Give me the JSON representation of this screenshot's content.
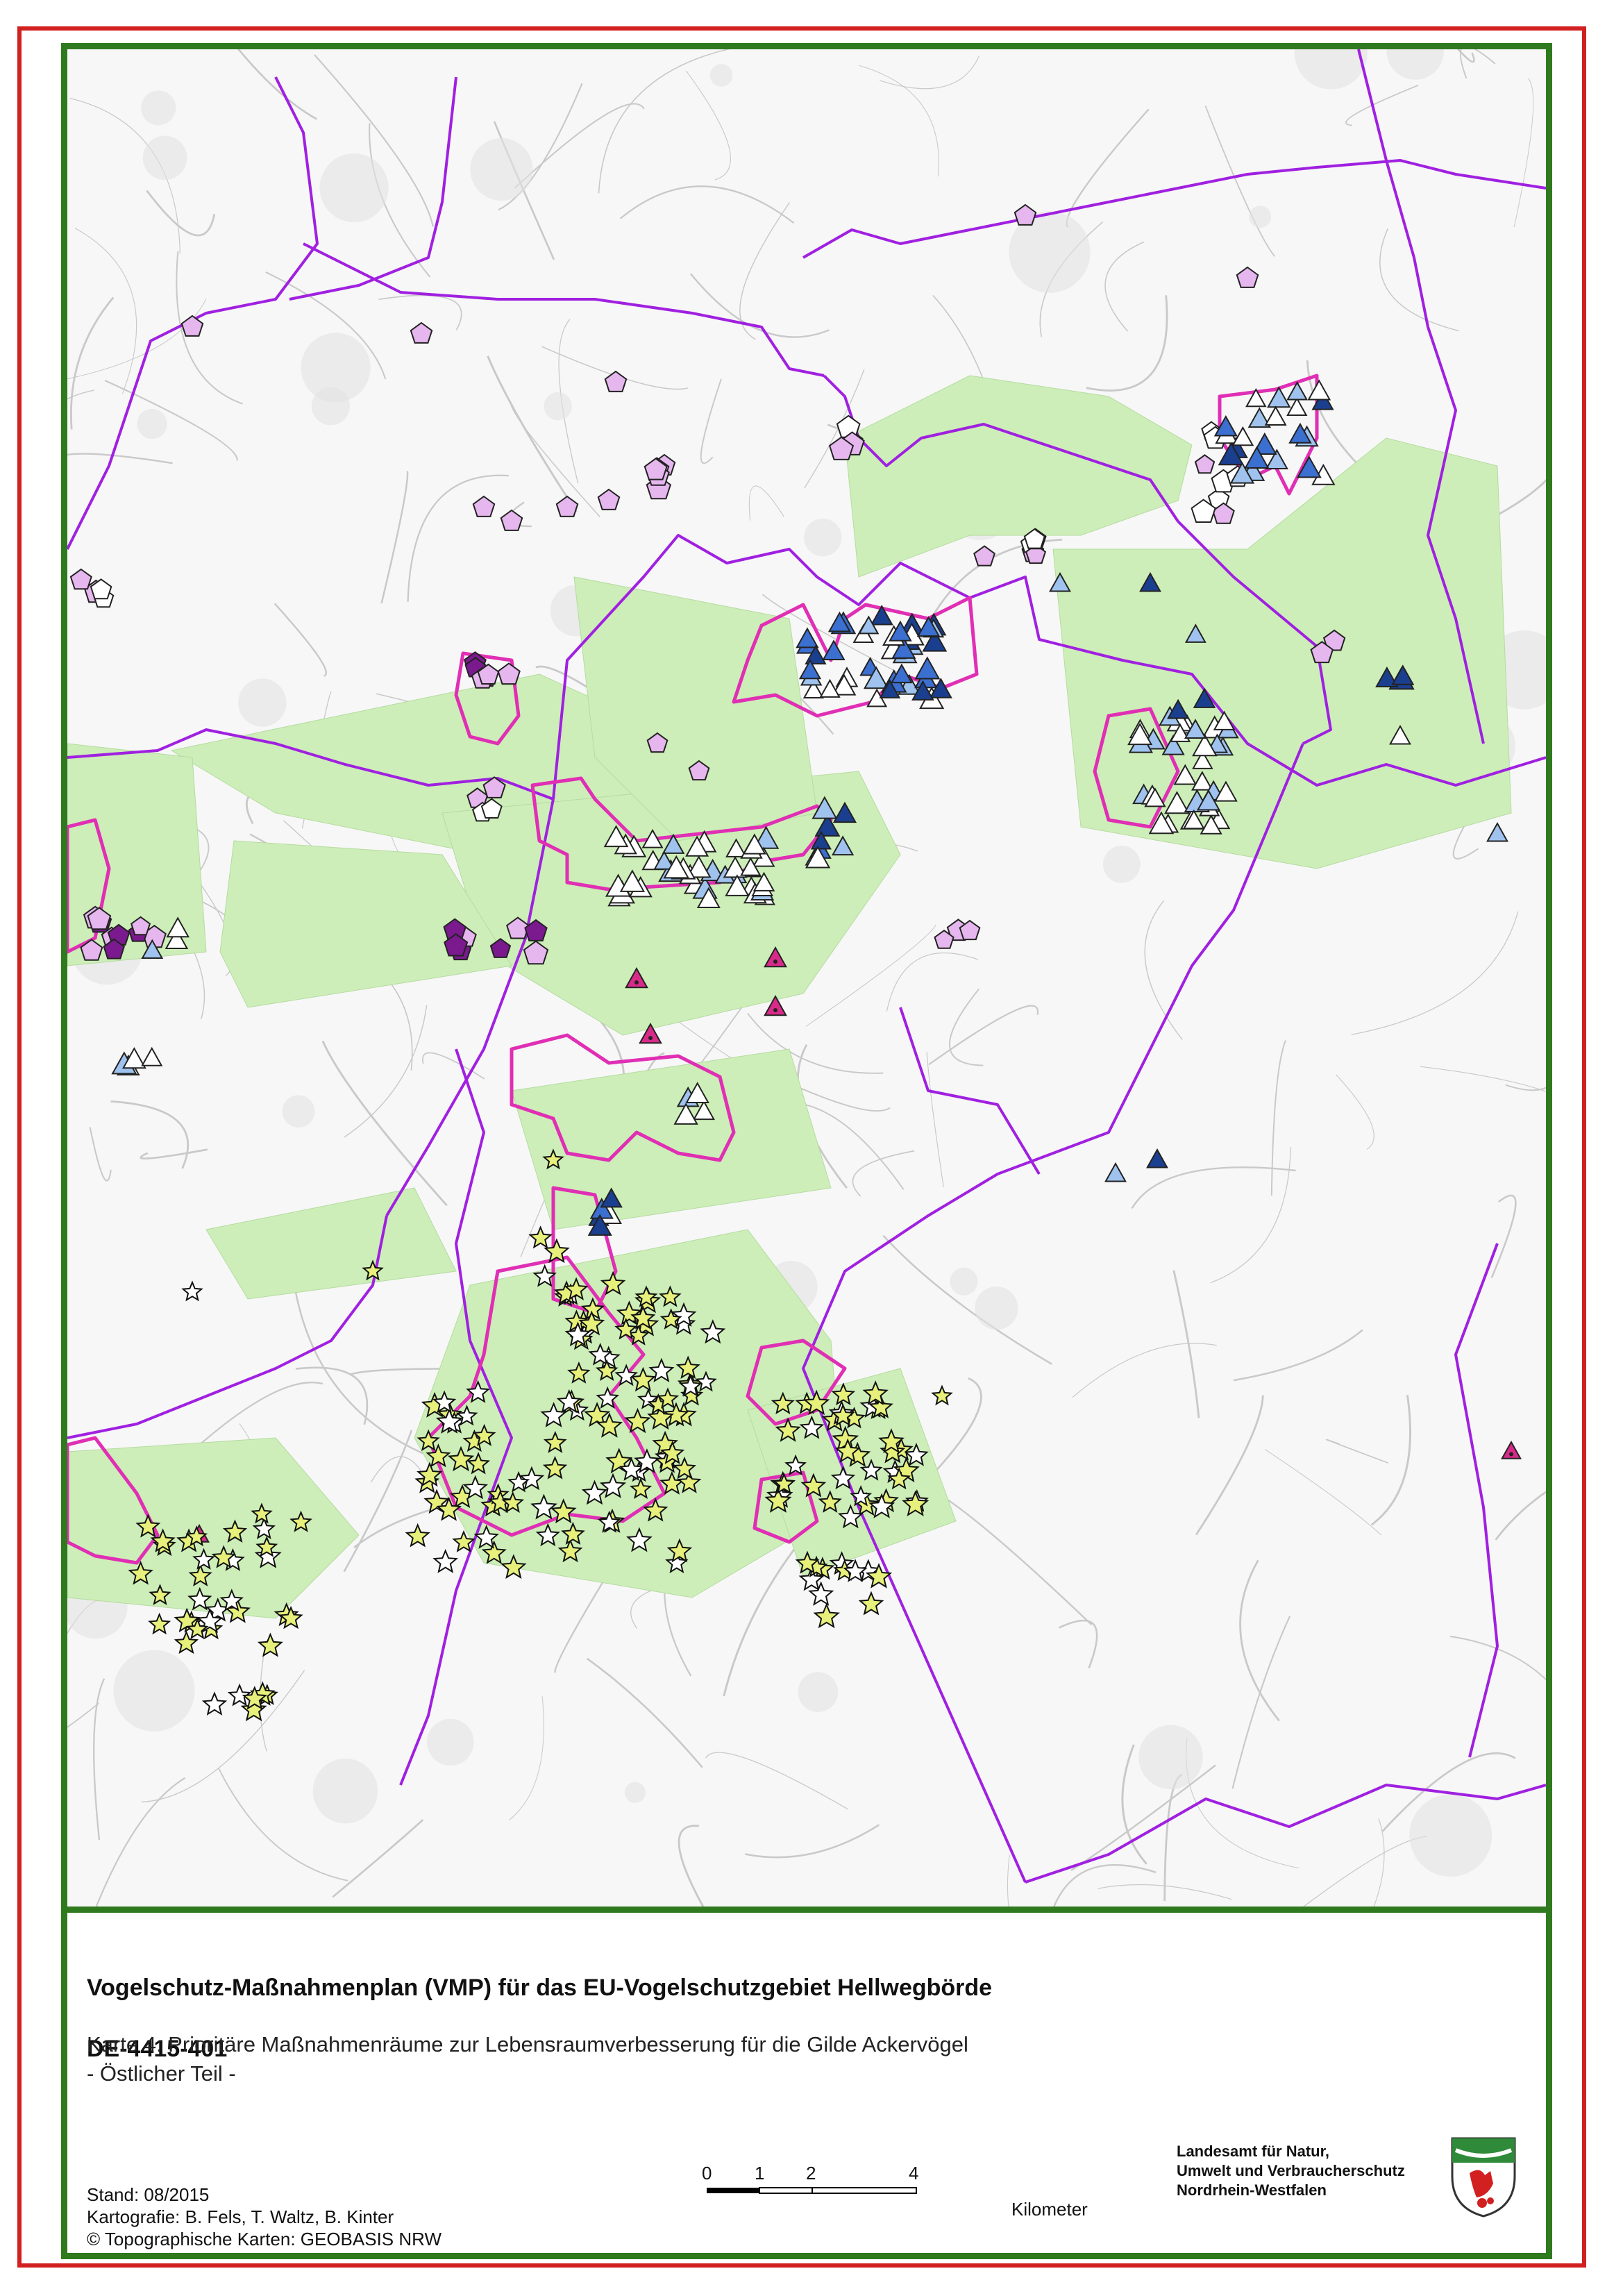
{
  "title": {
    "line1": "Vogelschutz-Maßnahmenplan (VMP) für das EU-Vogelschutzgebiet Hellwegbörde",
    "line2": "DE-4415-401"
  },
  "subtitle": {
    "line1": "Karte 4: Prioritäre Maßnahmenräume zur Lebensraumverbesserung für die Gilde Ackervögel",
    "line2": "- Östlicher Teil -"
  },
  "meta": {
    "stand": "Stand: 08/2015",
    "kartografie": "Kartografie: B. Fels, T. Waltz, B. Kinter",
    "copyright": "© Topographische Karten: GEOBASIS NRW"
  },
  "scalebar": {
    "ticks": [
      "0",
      "1",
      "2",
      "4"
    ],
    "unit": "Kilometer"
  },
  "agency": {
    "line1": "Landesamt für Natur,",
    "line2": "Umwelt und Verbraucherschutz",
    "line3": "Nordrhein-Westfalen"
  },
  "map": {
    "colors": {
      "green_area": "#cdeeb8",
      "priority_outline": "#e02fb4",
      "boundary": "#a020e0",
      "road": "#c9c9c9",
      "star_fill": "#e6f07a",
      "pentagon_light": "#e6b6ee",
      "pentagon_dark": "#7a1a8e",
      "triangle_light": "#9fc3ee",
      "triangle_dark": "#1b3f8f",
      "triangle_white": "#ffffff",
      "triangle_magenta": "#d92a8a"
    },
    "symbol_types": [
      "pentagon",
      "triangle",
      "star"
    ]
  }
}
